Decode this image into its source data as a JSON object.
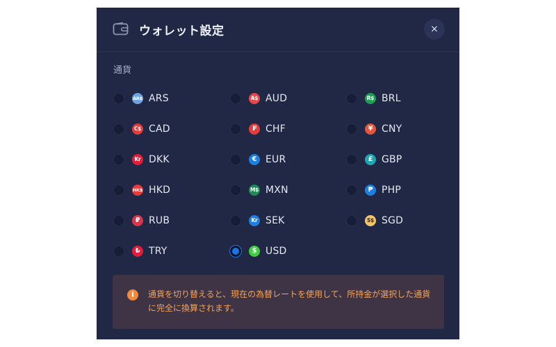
{
  "modal": {
    "title": "ウォレット設定",
    "close_label": "×",
    "section_label": "通貨",
    "notice": "通貨を切り替えると、現在の為替レートを使用して、所持金が選択した通貨に完全に換算されます。"
  },
  "currencies": [
    {
      "code": "ARS",
      "symbol": "AR$",
      "color": "#6ea5e0",
      "selected": false
    },
    {
      "code": "AUD",
      "symbol": "A$",
      "color": "#e8464a",
      "selected": false
    },
    {
      "code": "BRL",
      "symbol": "R$",
      "color": "#1f9e53",
      "selected": false
    },
    {
      "code": "CAD",
      "symbol": "C$",
      "color": "#e43b3b",
      "selected": false
    },
    {
      "code": "CHF",
      "symbol": "₣",
      "color": "#e43b3b",
      "selected": false
    },
    {
      "code": "CNY",
      "symbol": "¥",
      "color": "#e5553d",
      "selected": false
    },
    {
      "code": "DKK",
      "symbol": "Kr",
      "color": "#e21d3a",
      "selected": false
    },
    {
      "code": "EUR",
      "symbol": "€",
      "color": "#1d7fe0",
      "selected": false
    },
    {
      "code": "GBP",
      "symbol": "£",
      "color": "#1fa7b0",
      "selected": false
    },
    {
      "code": "HKD",
      "symbol": "HK$",
      "color": "#e43b3b",
      "selected": false
    },
    {
      "code": "MXN",
      "symbol": "M$",
      "color": "#1f8a55",
      "selected": false
    },
    {
      "code": "PHP",
      "symbol": "₱",
      "color": "#1d7fe0",
      "selected": false
    },
    {
      "code": "RUB",
      "symbol": "₽",
      "color": "#d8344a",
      "selected": false
    },
    {
      "code": "SEK",
      "symbol": "Kr",
      "color": "#1d7fe0",
      "selected": false
    },
    {
      "code": "SGD",
      "symbol": "S$",
      "color": "#f2c56b",
      "selected": false
    },
    {
      "code": "TRY",
      "symbol": "₺",
      "color": "#e21d3a",
      "selected": false
    },
    {
      "code": "USD",
      "symbol": "$",
      "color": "#3ecf3e",
      "selected": true
    }
  ],
  "colors": {
    "modal_bg": "#212845",
    "accent": "#1a73e8",
    "notice_text": "#f2a35a"
  }
}
